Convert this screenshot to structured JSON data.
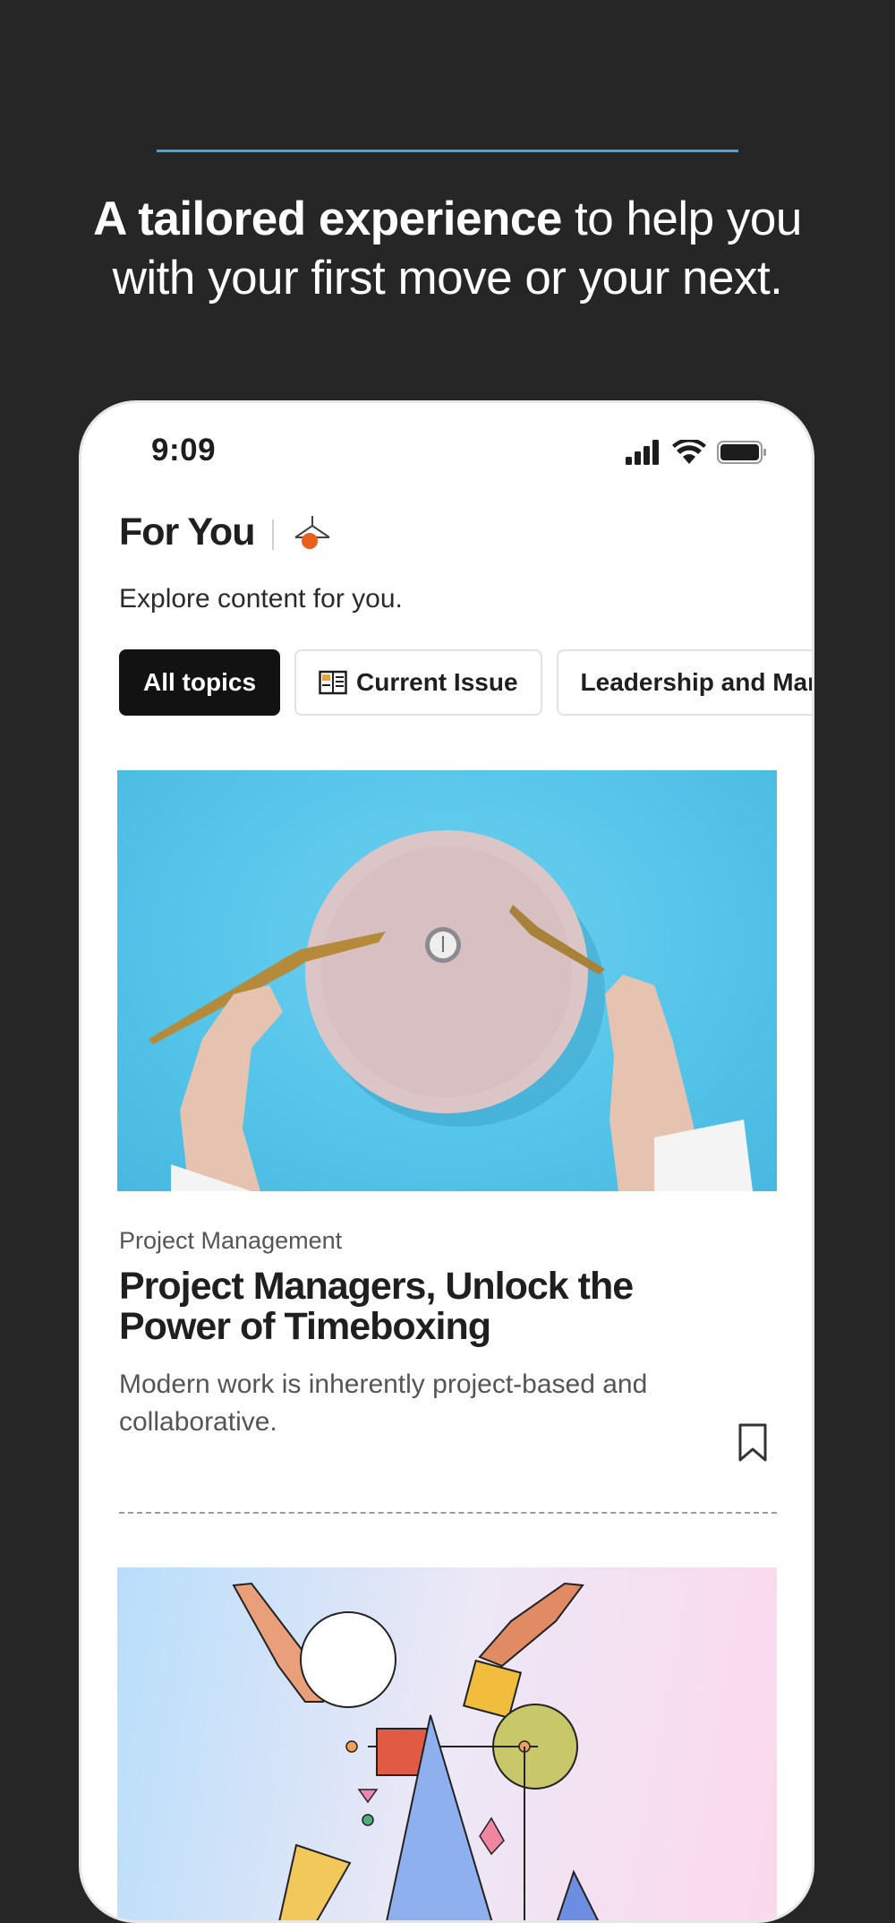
{
  "header": {
    "headline_bold": "A tailored experience",
    "headline_rest": " to help you with your first move or your next."
  },
  "status_bar": {
    "time": "9:09",
    "icons": [
      "cellular-signal-icon",
      "wifi-icon",
      "battery-icon"
    ]
  },
  "page": {
    "title": "For You",
    "subtitle": "Explore content for you."
  },
  "chips": [
    {
      "label": "All topics",
      "active": true
    },
    {
      "label": "Current Issue",
      "icon": "magazine-icon"
    },
    {
      "label": "Leadership and Mar"
    }
  ],
  "article": {
    "category": "Project Management",
    "title": "Project Managers, Unlock the Power of Timeboxing",
    "description": "Modern work is inherently project-based and collaborative."
  },
  "colors": {
    "background": "#262627",
    "accent_line": "#4aa3df",
    "active_chip": "#121212",
    "logo_dot": "#e8601c"
  }
}
